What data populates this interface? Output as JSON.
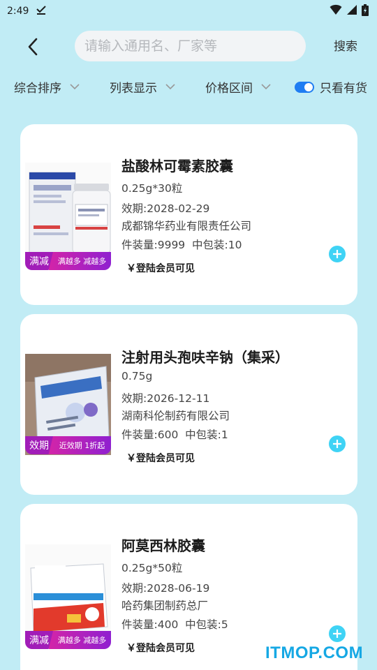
{
  "status": {
    "time": "2:49"
  },
  "header": {
    "search_placeholder": "请输入通用名、厂家等",
    "search_label": "搜索"
  },
  "filters": {
    "sort": "综合排序",
    "display": "列表显示",
    "price_range": "价格区间",
    "in_stock_only": "只看有货",
    "in_stock_enabled": true
  },
  "products": [
    {
      "name": "盐酸林可霉素胶囊",
      "spec": "0.25g*30粒",
      "expiry": "效期:2028-02-29",
      "manufacturer": "成都锦华药业有限责任公司",
      "pack": "件装量:9999  中包装:10",
      "price_text": "￥登陆会员可见",
      "promo_tag": "满减",
      "promo_text": "满越多 减越多"
    },
    {
      "name": "注射用头孢呋辛钠（集采）",
      "spec": "0.75g",
      "expiry": "效期:2026-12-11",
      "manufacturer": "湖南科伦制药有限公司",
      "pack": "件装量:600  中包装:1",
      "price_text": "￥登陆会员可见",
      "promo_tag": "效期",
      "promo_text": "近效期 1折起"
    },
    {
      "name": "阿莫西林胶囊",
      "spec": "0.25g*50粒",
      "expiry": "效期:2028-06-19",
      "manufacturer": "哈药集团制药总厂",
      "pack": "件装量:400  中包装:5",
      "price_text": "￥登陆会员可见",
      "promo_tag": "满减",
      "promo_text": "满越多 减越多"
    }
  ],
  "watermark": "ITMOP.COM"
}
